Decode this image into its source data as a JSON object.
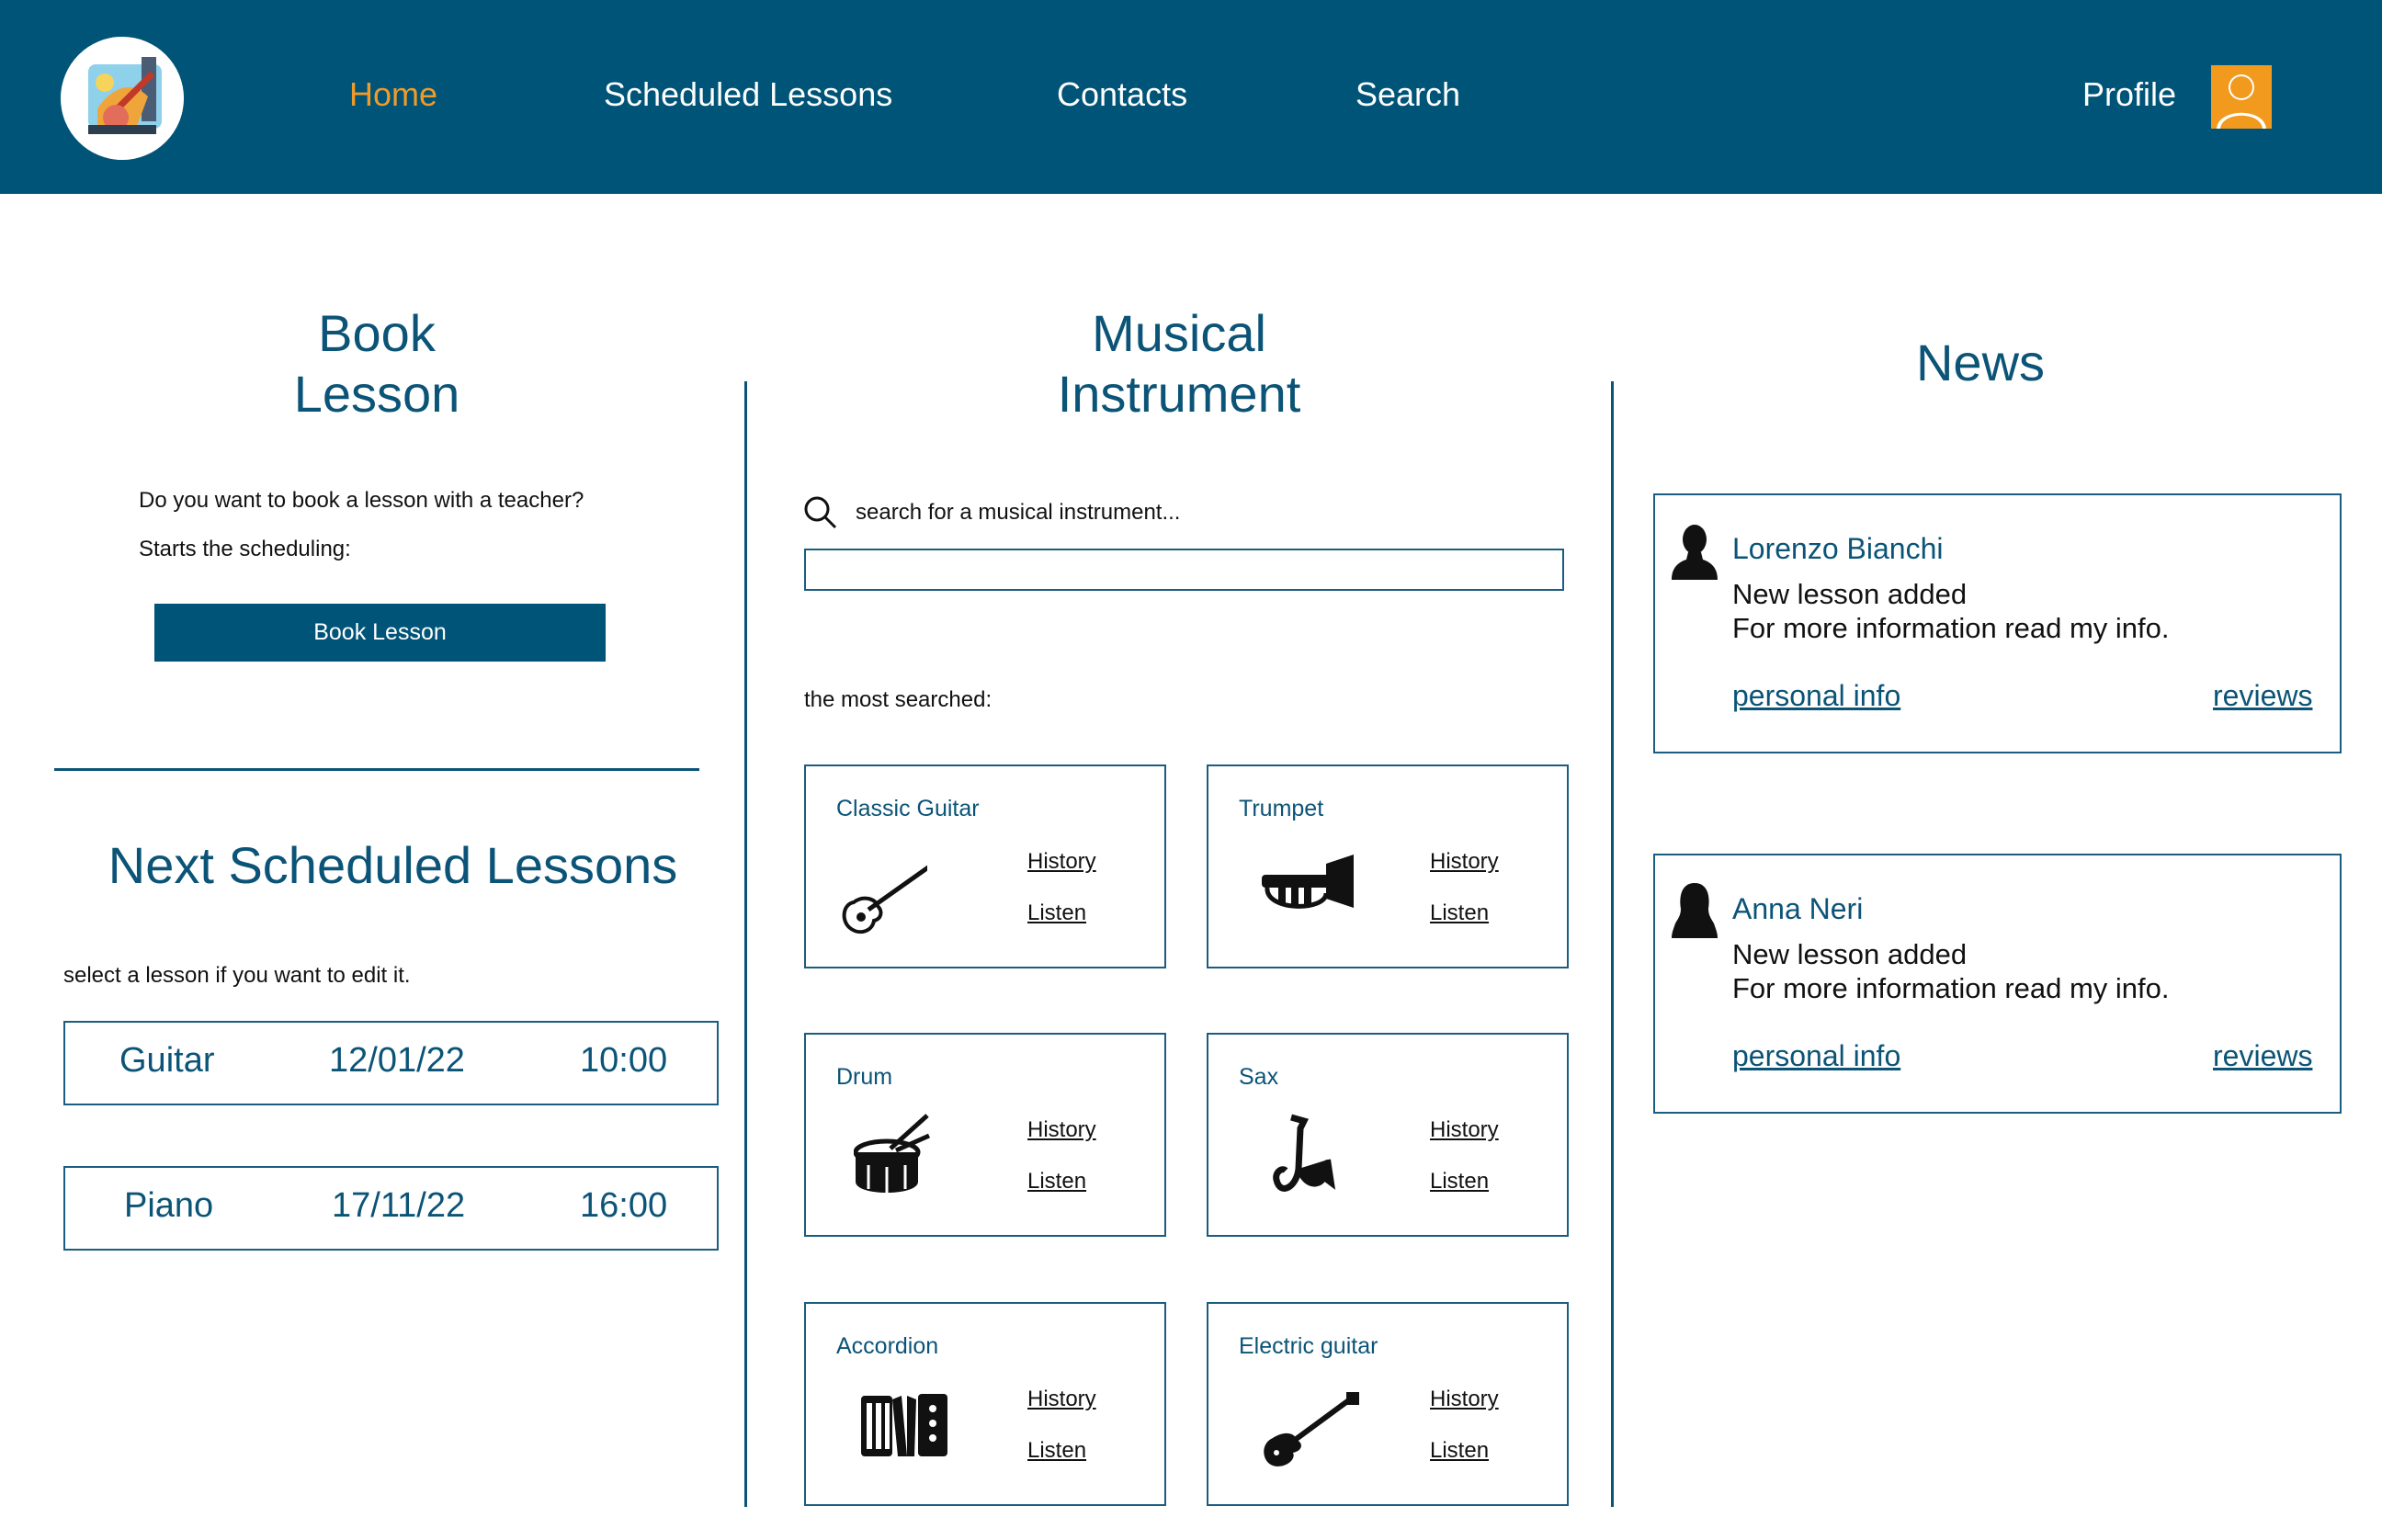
{
  "header": {
    "logo": "music-logo",
    "nav": [
      {
        "label": "Home",
        "active": true
      },
      {
        "label": "Scheduled Lessons",
        "active": false
      },
      {
        "label": "Contacts",
        "active": false
      },
      {
        "label": "Search",
        "active": false
      }
    ],
    "profile_label": "Profile",
    "profile_icon": "user-avatar-icon"
  },
  "book_lesson": {
    "title_line1": "Book",
    "title_line2": "Lesson",
    "question": "Do you want to book a lesson with a teacher?",
    "prompt": "Starts the scheduling:",
    "button_label": "Book Lesson"
  },
  "next_lessons": {
    "title": "Next Scheduled Lessons",
    "hint": "select a lesson if you want to edit it.",
    "items": [
      {
        "instrument": "Guitar",
        "date": "12/01/22",
        "time": "10:00"
      },
      {
        "instrument": "Piano",
        "date": "17/11/22",
        "time": "16:00"
      }
    ]
  },
  "instruments": {
    "title_line1": "Musical",
    "title_line2": "Instrument",
    "search_label": "search for a musical instrument...",
    "search_value": "",
    "most_searched_label": "the most searched:",
    "cards": [
      {
        "name": "Classic Guitar",
        "icon": "classic-guitar-icon",
        "history": "History",
        "listen": "Listen"
      },
      {
        "name": "Trumpet",
        "icon": "trumpet-icon",
        "history": "History",
        "listen": "Listen"
      },
      {
        "name": "Drum",
        "icon": "drum-icon",
        "history": "History",
        "listen": "Listen"
      },
      {
        "name": "Sax",
        "icon": "sax-icon",
        "history": "History",
        "listen": "Listen"
      },
      {
        "name": "Accordion",
        "icon": "accordion-icon",
        "history": "History",
        "listen": "Listen"
      },
      {
        "name": "Electric guitar",
        "icon": "electric-guitar-icon",
        "history": "History",
        "listen": "Listen"
      }
    ]
  },
  "news": {
    "title": "News",
    "items": [
      {
        "name": "Lorenzo Bianchi",
        "line1": "New lesson added",
        "line2": "For more information read my info.",
        "info_link": "personal info",
        "reviews_link": "reviews",
        "icon": "male-silhouette-icon"
      },
      {
        "name": "Anna Neri",
        "line1": "New lesson added",
        "line2": "For more information read my info.",
        "info_link": "personal info",
        "reviews_link": "reviews",
        "icon": "female-silhouette-icon"
      }
    ]
  },
  "colors": {
    "header_bg": "#005478",
    "accent": "#f09a2a",
    "heading": "#0b5477"
  }
}
